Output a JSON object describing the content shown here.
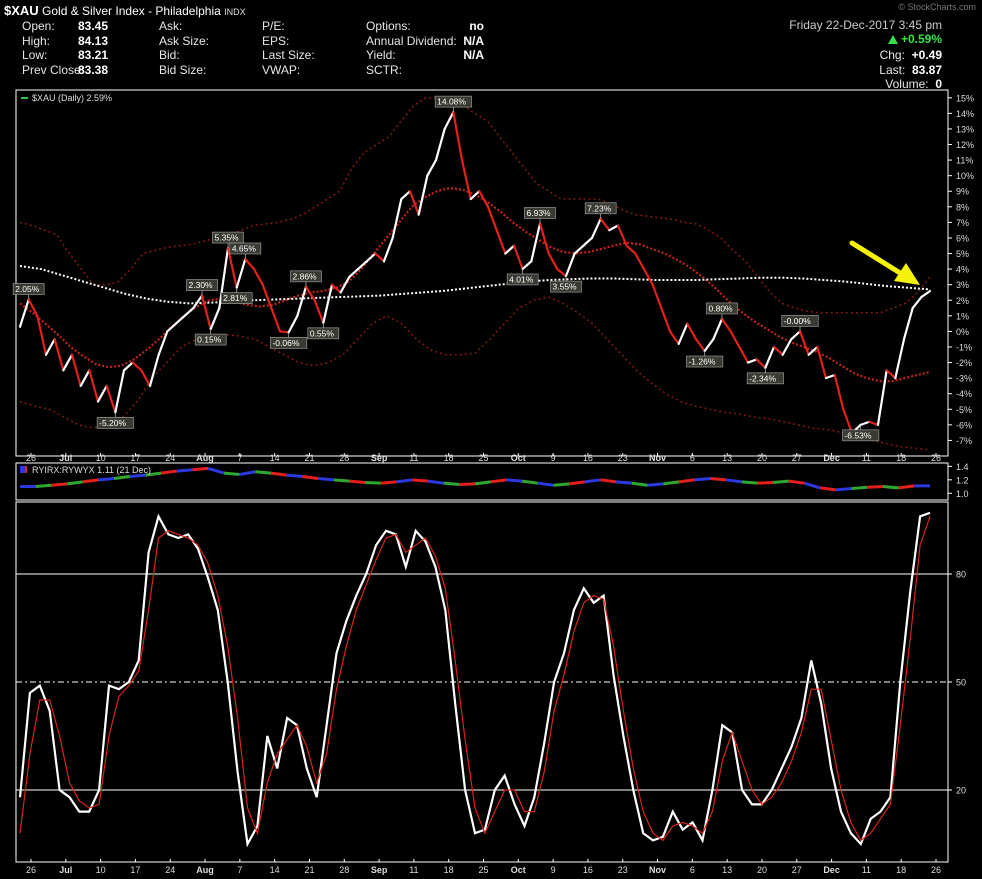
{
  "header": {
    "symbol": "$XAU",
    "name": "Gold & Silver Index - Philadelphia",
    "exchange": "INDX",
    "watermark": "© StockCharts.com",
    "date": "Friday  22-Dec-2017  3:45 pm",
    "change_pct": "+0.59%",
    "col1": [
      {
        "label": "Open:",
        "value": "83.45"
      },
      {
        "label": "High:",
        "value": "84.13"
      },
      {
        "label": "Low:",
        "value": "83.21"
      },
      {
        "label": "Prev Close:",
        "value": "83.38"
      }
    ],
    "col2": [
      {
        "label": "Ask:",
        "value": ""
      },
      {
        "label": "Ask Size:",
        "value": ""
      },
      {
        "label": "Bid:",
        "value": ""
      },
      {
        "label": "Bid Size:",
        "value": ""
      }
    ],
    "col3": [
      {
        "label": "P/E:",
        "value": ""
      },
      {
        "label": "EPS:",
        "value": ""
      },
      {
        "label": "Last Size:",
        "value": ""
      },
      {
        "label": "VWAP:",
        "value": ""
      }
    ],
    "col4": [
      {
        "label": "Options:",
        "value": "no"
      },
      {
        "label": "Annual Dividend:",
        "value": "N/A"
      },
      {
        "label": "Yield:",
        "value": "N/A"
      },
      {
        "label": "SCTR:",
        "value": ""
      }
    ],
    "right": [
      {
        "label": "Chg:",
        "value": "+0.49"
      },
      {
        "label": "Last:",
        "value": "83.87"
      },
      {
        "label": "Volume:",
        "value": "0"
      }
    ]
  },
  "chart_data": [
    {
      "type": "line",
      "legend": "$XAU (Daily) 2.59%",
      "y_unit": "percent",
      "ylim": [
        -8,
        15.5
      ],
      "y_ticks": [
        "15%",
        "14%",
        "13%",
        "12%",
        "11%",
        "10%",
        "9%",
        "8%",
        "7%",
        "6%",
        "5%",
        "4%",
        "3%",
        "2%",
        "1%",
        "0%",
        "-1%",
        "-2%",
        "-3%",
        "-4%",
        "-5%",
        "-6%",
        "-7%"
      ],
      "y_tick_values": [
        15,
        14,
        13,
        12,
        11,
        10,
        9,
        8,
        7,
        6,
        5,
        4,
        3,
        2,
        1,
        0,
        -1,
        -2,
        -3,
        -4,
        -5,
        -6,
        -7
      ],
      "x_ticks": [
        "26",
        "Jul",
        "10",
        "17",
        "24",
        "Aug",
        "7",
        "14",
        "21",
        "28",
        "Sep",
        "11",
        "18",
        "25",
        "Oct",
        "9",
        "16",
        "23",
        "Nov",
        "6",
        "13",
        "20",
        "27",
        "Dec",
        "11",
        "18",
        "26"
      ],
      "x_bold": [
        "Jul",
        "Aug",
        "Sep",
        "Oct",
        "Nov",
        "Dec"
      ],
      "series": [
        {
          "name": "$XAU",
          "style": "price-up-white-down-red",
          "values": [
            0.3,
            2.05,
            1,
            -1.5,
            -0.5,
            -2.5,
            -1.5,
            -3.5,
            -2.5,
            -4.5,
            -3.5,
            -5.2,
            -2.5,
            -2,
            -2.5,
            -3.5,
            -1.5,
            0,
            0.5,
            1,
            1.5,
            2.3,
            0.15,
            1.5,
            5.35,
            2.81,
            4.65,
            4,
            3,
            1.5,
            0,
            -0.06,
            1,
            2.86,
            2,
            0.55,
            3,
            2.5,
            3.5,
            4,
            4.5,
            5,
            4.5,
            6,
            8.5,
            9,
            7.5,
            10,
            11,
            13,
            14.08,
            11,
            8.5,
            9,
            8,
            6.5,
            5,
            5.5,
            4.01,
            4.5,
            6.93,
            5,
            4,
            3.55,
            5,
            5.5,
            6,
            7.23,
            6.5,
            6.8,
            5.5,
            5,
            4,
            3,
            1.5,
            0,
            -0.8,
            0.5,
            -0.5,
            -1.26,
            -0.5,
            0.8,
            0,
            -1,
            -2,
            -1.8,
            -2.34,
            -1,
            -1.5,
            -0.5,
            -0.0,
            -1.5,
            -1,
            -3,
            -2.8,
            -5,
            -6.53,
            -6,
            -5.8,
            -6,
            -2.5,
            -3,
            -0.5,
            1.5,
            2.2,
            2.59
          ]
        },
        {
          "name": "Upper band",
          "style": "dotted-darkred",
          "values": [
            7,
            6.8,
            6.5,
            6.2,
            5,
            4,
            3,
            3,
            3.2,
            4,
            5,
            5.2,
            5.4,
            5.5,
            5.6,
            5.8,
            6,
            6.2,
            6.5,
            6.8,
            6.9,
            7,
            7.2,
            7.5,
            8,
            8.5,
            9,
            10.5,
            11.5,
            12,
            12.5,
            13.5,
            14.5,
            15,
            15,
            14.8,
            14.5,
            14,
            13.5,
            12.5,
            11.5,
            10.5,
            9.5,
            9,
            8.5,
            8.5,
            8.5,
            8.5,
            8.2,
            7.8,
            7.5,
            7.4,
            7.3,
            7.2,
            7,
            6.9,
            6.5,
            6,
            5.2,
            4.5,
            3.5,
            2.5,
            1.8,
            1.5,
            1.3,
            1.2,
            1.2,
            1.2,
            1.2,
            1.2,
            1.2,
            1.5,
            1.8,
            2.5,
            3.5
          ]
        },
        {
          "name": "Lower band",
          "style": "dotted-darkred",
          "values": [
            -4.5,
            -4.8,
            -5,
            -5.5,
            -6,
            -6.2,
            -6,
            -5.5,
            -4.5,
            -3,
            -2,
            -1,
            -0.5,
            -0.3,
            -0.2,
            -0.3,
            -0.5,
            -1,
            -1.5,
            -2,
            -2.2,
            -2,
            -1.5,
            -0.5,
            0.5,
            1,
            0.5,
            -0.5,
            -1.2,
            -1.5,
            -1.5,
            -1.4,
            -0.5,
            0.5,
            1.5,
            2,
            2.2,
            1.8,
            1.2,
            0.5,
            -0.5,
            -1.5,
            -2.5,
            -3.3,
            -4,
            -4.5,
            -4.8,
            -5,
            -5.2,
            -5.3,
            -5.5,
            -5.6,
            -5.8,
            -6,
            -6.2,
            -6.3,
            -6.5,
            -6.8,
            -7,
            -7.2,
            -7.4,
            -7.5,
            -7.6
          ]
        },
        {
          "name": "MA short",
          "style": "dotted-red",
          "values": [
            1.8,
            1.2,
            0.5,
            -0.2,
            -1,
            -1.6,
            -2.1,
            -2.3,
            -2.2,
            -1.8,
            -1.2,
            -0.5,
            0.3,
            1,
            1.6,
            2,
            2.1,
            1.9,
            1.7,
            1.6,
            1.7,
            2,
            2.3,
            2.5,
            2.6,
            2.8,
            3.2,
            4,
            5,
            6,
            7,
            8,
            8.6,
            9,
            9.2,
            9.1,
            8.8,
            8.3,
            7.7,
            7,
            6.4,
            5.9,
            5.4,
            5.1,
            5,
            5.1,
            5.3,
            5.5,
            5.7,
            5.6,
            5.3,
            5,
            4.6,
            4.1,
            3.5,
            2.8,
            2,
            1.3,
            0.7,
            0.2,
            -0.3,
            -0.7,
            -1,
            -1.3,
            -1.7,
            -2.2,
            -2.7,
            -3,
            -3.2,
            -3.2,
            -3,
            -2.8,
            -2.6
          ]
        },
        {
          "name": "MA long",
          "style": "dotted-white",
          "values": [
            4.2,
            4,
            3.6,
            3.2,
            2.8,
            2.4,
            2.1,
            1.9,
            1.8,
            1.85,
            1.9,
            2,
            2.05,
            2.1,
            2.15,
            2.2,
            2.25,
            2.3,
            2.4,
            2.5,
            2.6,
            2.75,
            2.9,
            3.05,
            3.2,
            3.3,
            3.35,
            3.4,
            3.4,
            3.35,
            3.3,
            3.3,
            3.3,
            3.35,
            3.4,
            3.45,
            3.45,
            3.4,
            3.3,
            3.2,
            3.05,
            2.9,
            2.8,
            2.7
          ]
        }
      ],
      "annotations": [
        {
          "i": 1,
          "text": "2.05%"
        },
        {
          "i": 11,
          "text": "-5.20%"
        },
        {
          "i": 21,
          "text": "2.30%"
        },
        {
          "i": 22,
          "text": "0.15%"
        },
        {
          "i": 24,
          "text": "5.35%"
        },
        {
          "i": 25,
          "text": "2.81%"
        },
        {
          "i": 26,
          "text": "4.65%"
        },
        {
          "i": 31,
          "text": "-0.06%"
        },
        {
          "i": 33,
          "text": "2.86%"
        },
        {
          "i": 35,
          "text": "0.55%"
        },
        {
          "i": 50,
          "text": "14.08%"
        },
        {
          "i": 58,
          "text": "4.01%"
        },
        {
          "i": 60,
          "text": "6.93%"
        },
        {
          "i": 63,
          "text": "3.55%"
        },
        {
          "i": 67,
          "text": "7.23%"
        },
        {
          "i": 79,
          "text": "-1.26%"
        },
        {
          "i": 81,
          "text": "0.80%"
        },
        {
          "i": 86,
          "text": "-2.34%"
        },
        {
          "i": 90,
          "text": "-0.00%"
        },
        {
          "i": 97,
          "text": "-6.53%"
        }
      ]
    },
    {
      "type": "line",
      "legend": "RYIRX:RYWYX 1.11 (21 Dec)",
      "ylim": [
        0.9,
        1.45
      ],
      "y_ticks": [
        "1.4",
        "1.2",
        "1.0"
      ],
      "y_tick_values": [
        1.4,
        1.2,
        1.0
      ],
      "colors": [
        "red",
        "blue",
        "green",
        "red",
        "blue",
        "green",
        "red",
        "blue",
        "green",
        "red",
        "blue",
        "green",
        "red",
        "blue",
        "green",
        "red",
        "blue",
        "green",
        "red",
        "blue",
        "green",
        "red",
        "blue",
        "green",
        "red",
        "blue"
      ],
      "values": [
        1.1,
        1.1,
        1.12,
        1.14,
        1.17,
        1.2,
        1.22,
        1.25,
        1.27,
        1.3,
        1.33,
        1.35,
        1.37,
        1.3,
        1.28,
        1.32,
        1.3,
        1.27,
        1.25,
        1.22,
        1.2,
        1.18,
        1.16,
        1.15,
        1.17,
        1.2,
        1.18,
        1.15,
        1.13,
        1.14,
        1.17,
        1.2,
        1.18,
        1.15,
        1.12,
        1.14,
        1.17,
        1.2,
        1.17,
        1.15,
        1.12,
        1.14,
        1.17,
        1.2,
        1.22,
        1.2,
        1.17,
        1.15,
        1.16,
        1.18,
        1.15,
        1.08,
        1.05,
        1.07,
        1.09,
        1.1,
        1.08,
        1.11,
        1.11
      ]
    },
    {
      "type": "line",
      "ylim": [
        0,
        100
      ],
      "y_ticks": [
        "80",
        "50",
        "20"
      ],
      "y_tick_values": [
        80,
        50,
        20
      ],
      "reference_lines": [
        80,
        50,
        20
      ],
      "series": [
        {
          "name": "%K",
          "color": "white",
          "values": [
            18,
            47,
            49,
            42,
            20,
            18,
            14,
            14,
            20,
            49,
            48,
            50,
            56,
            86,
            96,
            91,
            90,
            91,
            87,
            79,
            70,
            50,
            25,
            5,
            10,
            35,
            26,
            40,
            38,
            26,
            18,
            38,
            58,
            67,
            74,
            80,
            88,
            92,
            91,
            82,
            92,
            89,
            82,
            70,
            44,
            20,
            8,
            9,
            20,
            24,
            16,
            10,
            18,
            33,
            50,
            58,
            70,
            76,
            72,
            74,
            52,
            35,
            20,
            8,
            6,
            7,
            14,
            9,
            11,
            6,
            20,
            38,
            36,
            20,
            16,
            16,
            20,
            26,
            32,
            40,
            56,
            44,
            26,
            14,
            8,
            5,
            12,
            14,
            18,
            50,
            75,
            96,
            97
          ]
        },
        {
          "name": "%D",
          "color": "red",
          "values": [
            8,
            30,
            45,
            45,
            35,
            22,
            17,
            15,
            16,
            35,
            46,
            49,
            53,
            70,
            90,
            92,
            91,
            90,
            88,
            83,
            74,
            60,
            40,
            15,
            8,
            22,
            30,
            34,
            38,
            32,
            22,
            30,
            48,
            60,
            70,
            77,
            84,
            90,
            91,
            86,
            88,
            90,
            85,
            76,
            56,
            34,
            15,
            8,
            14,
            20,
            20,
            14,
            14,
            25,
            42,
            52,
            64,
            72,
            74,
            73,
            60,
            42,
            26,
            14,
            8,
            6,
            10,
            11,
            10,
            8,
            14,
            28,
            36,
            28,
            20,
            16,
            18,
            22,
            28,
            36,
            48,
            48,
            34,
            20,
            11,
            6,
            8,
            12,
            16,
            38,
            62,
            88,
            96
          ]
        }
      ]
    }
  ]
}
